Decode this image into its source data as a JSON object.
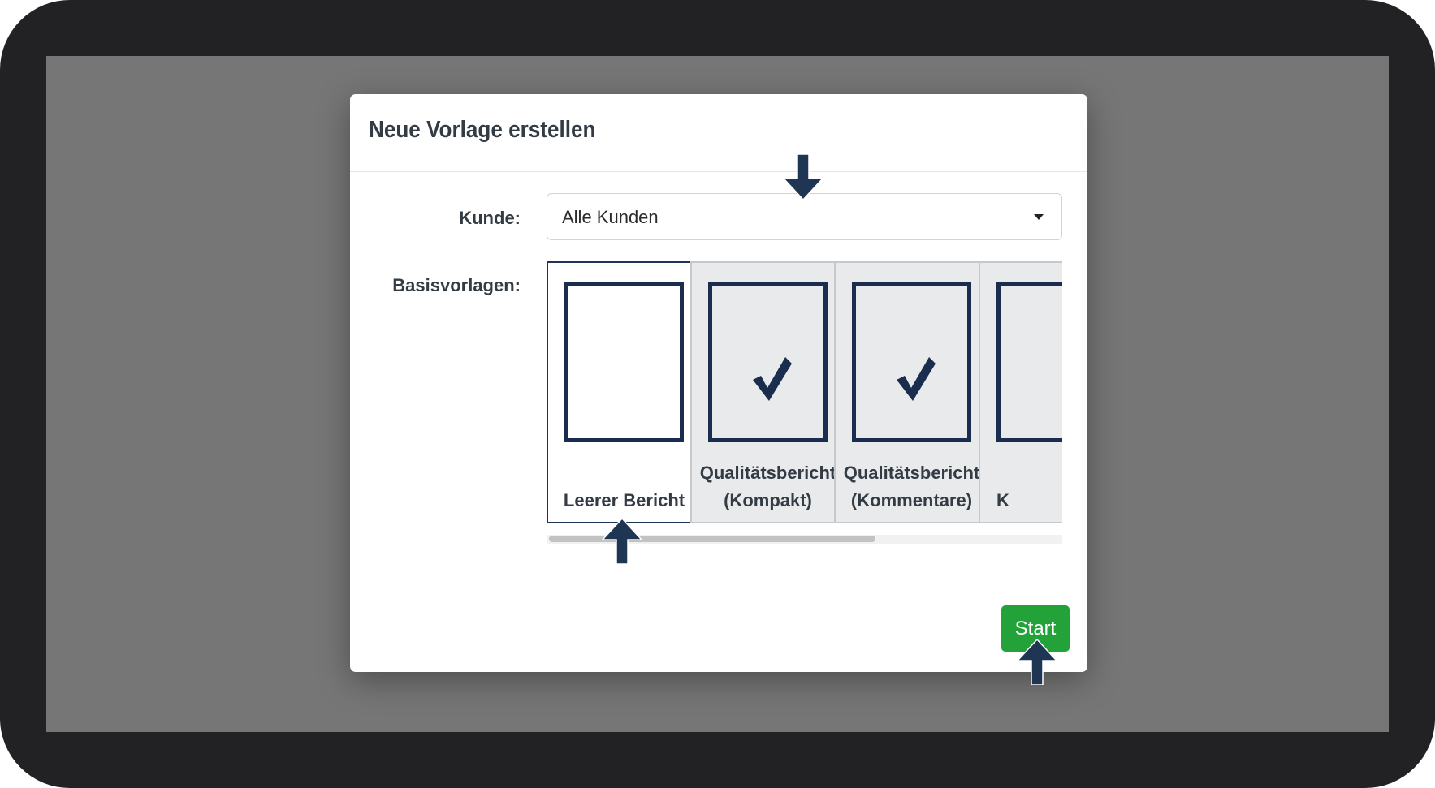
{
  "dialog": {
    "title": "Neue Vorlage erstellen",
    "customer_label": "Kunde:",
    "customer_value": "Alle Kunden",
    "templates_label": "Basisvorlagen:",
    "templates": [
      {
        "line1": "",
        "line2": "Leerer Bericht",
        "selected": true,
        "icon": "blank-document-icon"
      },
      {
        "line1": "Qualitätsbericht",
        "line2": "(Kompakt)",
        "selected": false,
        "icon": "checked-document-icon"
      },
      {
        "line1": "Qualitätsbericht",
        "line2": "(Kommentare)",
        "selected": false,
        "icon": "checked-document-icon"
      },
      {
        "line1": "",
        "line2": "K",
        "selected": false,
        "icon": "document-icon"
      }
    ],
    "start_label": "Start"
  },
  "colors": {
    "frame": "#222123",
    "overlay": "#767676",
    "navy": "#1a2d4f",
    "start_button": "#23a23a",
    "card_bg": "#e9eaec"
  },
  "annotations": [
    "arrow-down-icon",
    "arrow-up-icon",
    "arrow-up-icon"
  ]
}
